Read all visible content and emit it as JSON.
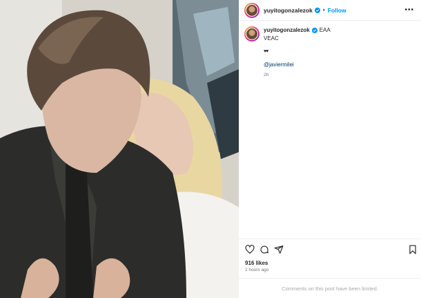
{
  "post": {
    "username": "yuyitogonzalezok",
    "follow_label": "Follow",
    "separator": "•",
    "more_label": "•••"
  },
  "caption": {
    "username": "yuyitogonzalezok",
    "tag": "EAA",
    "line1": "VEAC",
    "hearts": "♥♥",
    "mention": "@javiermilei",
    "relative_time": "2h"
  },
  "stats": {
    "likes": "916 likes",
    "posted_time": "2 hours ago"
  },
  "comments": {
    "limited_text": "Comments on this post have been limited."
  },
  "colors": {
    "accent": "#0095f6",
    "verified": "#0095f6",
    "mention": "#00376b",
    "muted": "#737373"
  },
  "icons": {
    "like": "heart-icon",
    "comment": "comment-icon",
    "share": "send-icon",
    "save": "bookmark-icon",
    "verified": "verified-badge-icon",
    "more": "more-options-icon"
  }
}
